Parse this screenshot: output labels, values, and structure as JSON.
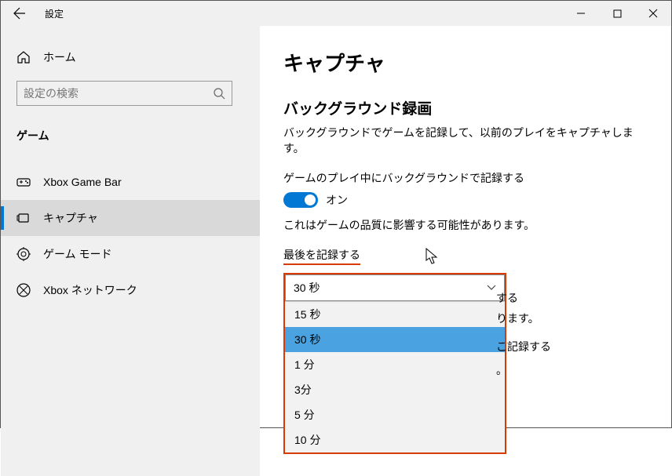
{
  "window": {
    "title": "設定"
  },
  "sidebar": {
    "home": "ホーム",
    "search_placeholder": "設定の検索",
    "category": "ゲーム",
    "items": [
      {
        "label": "Xbox Game Bar"
      },
      {
        "label": "キャプチャ"
      },
      {
        "label": "ゲーム モード"
      },
      {
        "label": "Xbox ネットワーク"
      }
    ]
  },
  "content": {
    "heading": "キャプチャ",
    "sub_heading": "バックグラウンド録画",
    "sub_desc": "バックグラウンドでゲームを記録して、以前のプレイをキャプチャします。",
    "toggle_label": "ゲームのプレイ中にバックグラウンドで記録する",
    "toggle_state": "オン",
    "toggle_warning": "これはゲームの品質に影響する可能性があります。",
    "record_last_label": "最後を記録する",
    "combo_selected": "30 秒",
    "options": [
      "15 秒",
      "30 秒",
      "1 分",
      "3分",
      "5 分",
      "10 分"
    ],
    "behind1": "する",
    "behind2": "ります。",
    "behind3": "こ記録する",
    "behind4": "。"
  }
}
